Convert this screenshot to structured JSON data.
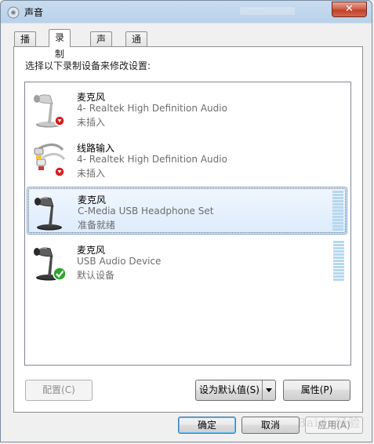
{
  "window": {
    "title": "声音",
    "close_label": "✕"
  },
  "tabs": [
    {
      "label": "播放"
    },
    {
      "label": "录制"
    },
    {
      "label": "声音"
    },
    {
      "label": "通信"
    }
  ],
  "panel": {
    "instruction": "选择以下录制设备来修改设置:"
  },
  "devices": [
    {
      "name": "麦克风",
      "description": "4- Realtek High Definition Audio",
      "status": "未插入",
      "icon": "microphone-icon",
      "badge": "unplugged-badge"
    },
    {
      "name": "线路输入",
      "description": "4- Realtek High Definition Audio",
      "status": "未插入",
      "icon": "line-in-icon",
      "badge": "unplugged-badge"
    },
    {
      "name": "麦克风",
      "description": "C-Media USB Headphone Set",
      "status": "准备就绪",
      "icon": "microphone-icon",
      "selected": true
    },
    {
      "name": "麦克风",
      "description": "USB Audio Device",
      "status": "默认设备",
      "icon": "microphone-icon",
      "badge": "default-check-badge"
    }
  ],
  "buttons": {
    "configure": "配置(C)",
    "set_default": "设为默认值(S)",
    "properties": "属性(P)",
    "ok": "确定",
    "cancel": "取消",
    "apply": "应用(A)"
  },
  "colors": {
    "selection": "#dcebfc",
    "meter": "#b6d8ee",
    "close": "#c2412a"
  },
  "watermark": "Baidu经验"
}
